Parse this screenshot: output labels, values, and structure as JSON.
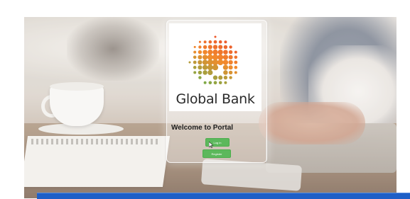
{
  "card": {
    "brand_name": "Global Bank",
    "welcome_text": "Welcome to Portal",
    "login_label": "Log in",
    "register_label": "Register"
  },
  "colors": {
    "button_green": "#5cb85c",
    "bottom_bar_blue": "#1e5fc7",
    "logo_red": "#e8412c",
    "logo_orange": "#f28b2c",
    "logo_green": "#6ab04c"
  },
  "icons": {
    "logo": "globe-dots-logo",
    "pointer": "mouse-pointer-icon"
  }
}
